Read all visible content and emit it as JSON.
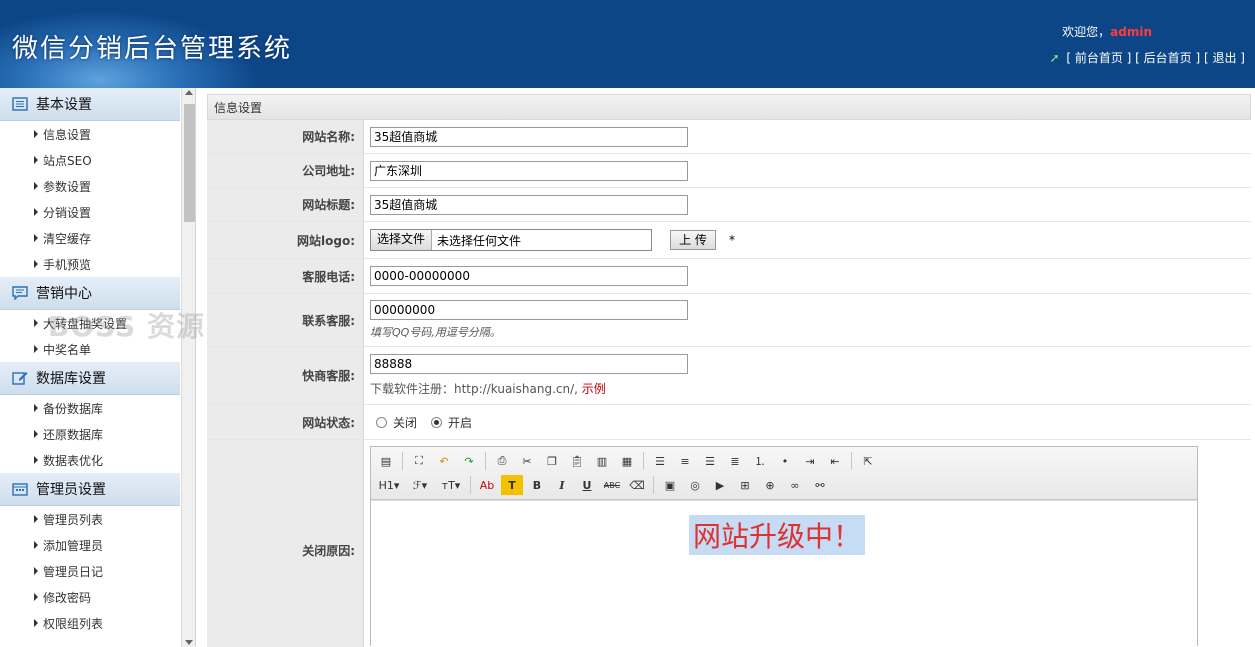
{
  "header": {
    "title": "微信分销后台管理系统",
    "welcome_prefix": "欢迎您，",
    "username": "admin",
    "links": [
      "[ 前台首页 ]",
      "[ 后台首页 ]",
      "[ 退出 ]"
    ]
  },
  "sidebar": {
    "sections": [
      {
        "label": "基本设置",
        "icon": "list-icon",
        "items": [
          "信息设置",
          "站点SEO",
          "参数设置",
          "分销设置",
          "清空缓存",
          "手机预览"
        ]
      },
      {
        "label": "营销中心",
        "icon": "comment-icon",
        "items": [
          "大转盘抽奖设置",
          "中奖名单"
        ]
      },
      {
        "label": "数据库设置",
        "icon": "edit-icon",
        "items": [
          "备份数据库",
          "还原数据库",
          "数据表优化"
        ]
      },
      {
        "label": "管理员设置",
        "icon": "calendar-icon",
        "items": [
          "管理员列表",
          "添加管理员",
          "管理员日记",
          "修改密码",
          "权限组列表"
        ]
      }
    ]
  },
  "watermark": "BOSS 资源",
  "main": {
    "title": "信息设置",
    "fields": {
      "site_name": {
        "label": "网站名称:",
        "value": "35超值商城"
      },
      "company_addr": {
        "label": "公司地址:",
        "value": "广东深圳"
      },
      "site_title": {
        "label": "网站标题:",
        "value": "35超值商城"
      },
      "site_logo": {
        "label": "网站logo:",
        "file_button": "选择文件",
        "file_status": "未选择任何文件",
        "upload": "上 传",
        "required": "*"
      },
      "service_phone": {
        "label": "客服电话:",
        "value": "0000-00000000"
      },
      "contact_service": {
        "label": "联系客服:",
        "value": "00000000",
        "hint": "填写QQ号码,用逗号分隔。"
      },
      "kuaishang": {
        "label": "快商客服:",
        "value": "88888",
        "hint": "下载软件注册：http://kuaishang.cn/,",
        "example": "示例"
      },
      "site_status": {
        "label": "网站状态:",
        "options": [
          "关闭",
          "开启"
        ],
        "selected": "开启"
      },
      "close_reason": {
        "label": "关闭原因:",
        "content": "网站升级中！"
      }
    }
  },
  "toolbar_row2_text": {
    "h1": "H1",
    "font": "ℱ",
    "size": "тT",
    "ab": "Ab",
    "tcolor": "T",
    "bold": "B",
    "italic": "I",
    "underline": "U",
    "strike": "ABC"
  }
}
